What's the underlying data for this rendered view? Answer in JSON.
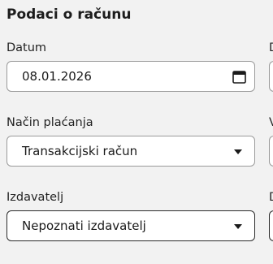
{
  "section": {
    "title": "Podaci o računu"
  },
  "fields": {
    "date": {
      "label": "Datum",
      "value": "08.01.2026"
    },
    "payment_method": {
      "label": "Način plaćanja",
      "value": "Transakcijski račun"
    },
    "issuer": {
      "label": "Izdavatelj",
      "value": "Nepoznati izdavatelj"
    }
  },
  "clipped_right_column": {
    "label_1": "D",
    "label_2": "V",
    "label_3": "D"
  },
  "icons": {
    "date": "calendar-icon",
    "dropdown": "chevron-down-icon"
  },
  "colors": {
    "background": "#f2f2f2",
    "field_background": "#ffffff",
    "border": "#9a9a9a",
    "border_focused": "#2b2b2b"
  }
}
